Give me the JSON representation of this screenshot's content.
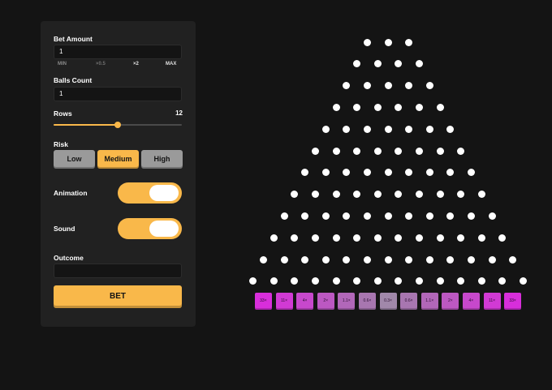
{
  "sidebar": {
    "bet_amount": {
      "label": "Bet Amount",
      "value": "1"
    },
    "multipliers": {
      "min": "MIN",
      "half": "×0.5",
      "double": "×2",
      "max": "MAX"
    },
    "balls_count": {
      "label": "Balls Count",
      "value": "1"
    },
    "rows": {
      "label": "Rows",
      "value": "12",
      "min": 8,
      "max": 16
    },
    "risk": {
      "label": "Risk",
      "options": [
        "Low",
        "Medium",
        "High"
      ],
      "selected": "Medium"
    },
    "animation": {
      "label": "Animation",
      "on": true
    },
    "sound": {
      "label": "Sound",
      "on": true
    },
    "outcome": {
      "label": "Outcome",
      "value": ""
    },
    "bet_button": "BET"
  },
  "board": {
    "rows": 12,
    "buckets": [
      "33×",
      "11×",
      "4×",
      "2×",
      "1.1×",
      "0.6×",
      "0.3×",
      "0.6×",
      "1.1×",
      "2×",
      "4×",
      "11×",
      "33×"
    ],
    "bucket_colors": [
      "#d82edb",
      "#d13ad4",
      "#c748cc",
      "#bc58c2",
      "#b267b9",
      "#a876b0",
      "#a188aa",
      "#a876b0",
      "#b267b9",
      "#bc58c2",
      "#c748cc",
      "#d13ad4",
      "#d82edb"
    ]
  },
  "colors": {
    "accent": "#f9b84a",
    "panel": "#212121",
    "background": "#141414"
  }
}
